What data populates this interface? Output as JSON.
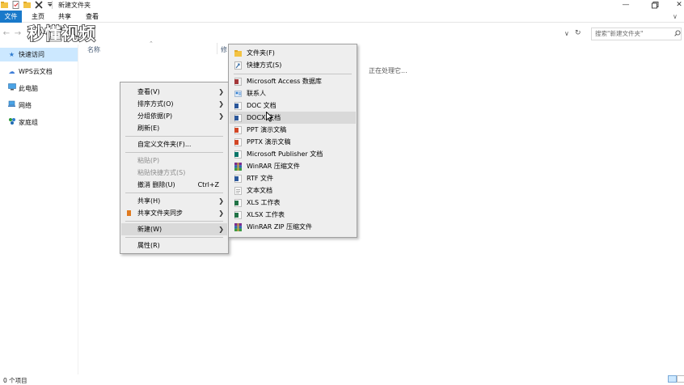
{
  "window": {
    "title": "新建文件夹"
  },
  "ribbon": {
    "tabs": [
      "文件",
      "主页",
      "共享",
      "查看"
    ]
  },
  "search": {
    "placeholder": "搜索\"新建文件夹\""
  },
  "watermark": {
    "text": "秒懂视频"
  },
  "nav": {
    "items": [
      {
        "label": "快速访问",
        "icon": "star-icon",
        "selected": true
      },
      {
        "label": "WPS云文档",
        "icon": "cloud-icon"
      },
      {
        "label": "此电脑",
        "icon": "computer-icon"
      },
      {
        "label": "网络",
        "icon": "network-icon"
      },
      {
        "label": "家庭组",
        "icon": "homegroup-icon"
      }
    ]
  },
  "columns": {
    "name": "名称",
    "modified": "修"
  },
  "content": {
    "processing": "正在处理它..."
  },
  "context_menu": {
    "items": [
      {
        "label": "查看(V)",
        "submenu": true
      },
      {
        "label": "排序方式(O)",
        "submenu": true
      },
      {
        "label": "分组依据(P)",
        "submenu": true
      },
      {
        "label": "刷新(E)"
      },
      {
        "separator": true
      },
      {
        "label": "自定义文件夹(F)..."
      },
      {
        "separator": true
      },
      {
        "label": "粘贴(P)",
        "disabled": true
      },
      {
        "label": "粘贴快捷方式(S)",
        "disabled": true
      },
      {
        "label": "撤消 删除(U)",
        "shortcut": "Ctrl+Z"
      },
      {
        "separator": true
      },
      {
        "label": "共享(H)",
        "submenu": true
      },
      {
        "label": "共享文件夹同步",
        "submenu": true,
        "icon": "sync-icon"
      },
      {
        "separator": true
      },
      {
        "label": "新建(W)",
        "submenu": true,
        "highlighted": true
      },
      {
        "separator": true
      },
      {
        "label": "属性(R)"
      }
    ]
  },
  "new_submenu": {
    "items": [
      {
        "label": "文件夹(F)",
        "icon": "folder-icon",
        "color": "#f3c343"
      },
      {
        "label": "快捷方式(S)",
        "icon": "shortcut-icon",
        "color": "#3a6ea5"
      },
      {
        "separator": true
      },
      {
        "label": "Microsoft Access 数据库",
        "icon": "access-icon",
        "color": "#a4373a"
      },
      {
        "label": "联系人",
        "icon": "contact-icon",
        "color": "#2e7bcf"
      },
      {
        "label": "DOC 文档",
        "icon": "doc-icon",
        "color": "#2b579a"
      },
      {
        "label": "DOCX 文档",
        "icon": "docx-icon",
        "color": "#2b579a",
        "highlighted": true
      },
      {
        "label": "PPT 演示文稿",
        "icon": "ppt-icon",
        "color": "#d24726"
      },
      {
        "label": "PPTX 演示文稿",
        "icon": "pptx-icon",
        "color": "#d24726"
      },
      {
        "label": "Microsoft Publisher 文档",
        "icon": "publisher-icon",
        "color": "#077568"
      },
      {
        "label": "WinRAR 压缩文件",
        "icon": "winrar-icon",
        "color": "#7b2d8e"
      },
      {
        "label": "RTF 文件",
        "icon": "rtf-icon",
        "color": "#2b579a"
      },
      {
        "label": "文本文档",
        "icon": "text-doc-icon",
        "color": "#9a9a9a"
      },
      {
        "label": "XLS 工作表",
        "icon": "xls-icon",
        "color": "#217346"
      },
      {
        "label": "XLSX 工作表",
        "icon": "xlsx-icon",
        "color": "#217346"
      },
      {
        "label": "WinRAR ZIP 压缩文件",
        "icon": "winrar-zip-icon",
        "color": "#7b2d8e"
      }
    ]
  },
  "status": {
    "items_count": "0 个项目"
  }
}
